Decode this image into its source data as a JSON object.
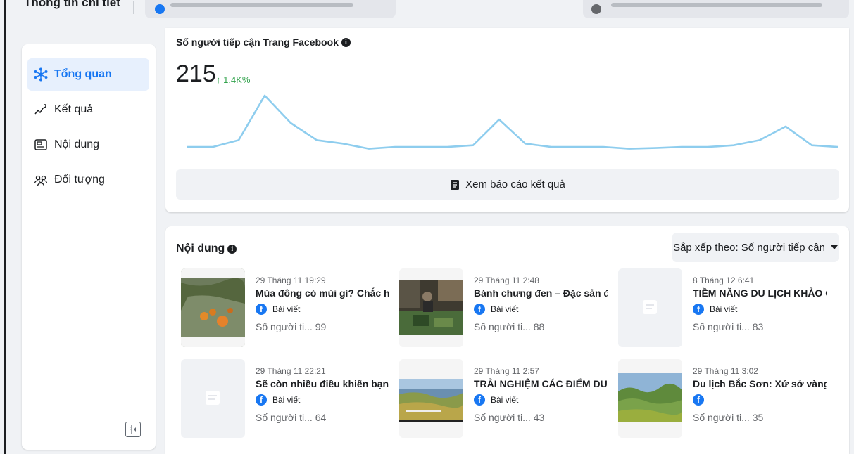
{
  "topbar": {
    "title": "Thông tin chi tiết"
  },
  "sidebar": {
    "items": [
      {
        "label": "Tổng quan",
        "icon": "overview-icon",
        "active": true
      },
      {
        "label": "Kết quả",
        "icon": "results-icon",
        "active": false
      },
      {
        "label": "Nội dung",
        "icon": "content-icon",
        "active": false
      },
      {
        "label": "Đối tượng",
        "icon": "audience-icon",
        "active": false
      }
    ]
  },
  "reach": {
    "title": "Số người tiếp cận Trang Facebook",
    "value": "215",
    "change": "↑ 1,4K%",
    "report_button": "Xem báo cáo kết quả",
    "chart_data": {
      "type": "line",
      "series": [
        {
          "values": [
            1,
            1,
            3,
            16,
            8,
            3,
            2,
            0.5,
            1,
            1,
            1,
            1.5,
            9,
            2,
            1,
            1,
            1,
            0.5,
            0.7,
            1,
            1,
            1.5,
            3,
            7,
            1.5,
            1
          ]
        }
      ],
      "grid": false,
      "color": "#8ecdee"
    }
  },
  "content": {
    "title": "Nội dung",
    "sort_label": "Sắp xếp theo: Số người tiếp cận",
    "posts": [
      {
        "date": "29 Tháng 11 19:29",
        "title": "Mùa đông có mùi gì? Chắc hẳ...",
        "type": "Bài viết",
        "reach": "Số người ti... 99",
        "thumb": "photo-oranges"
      },
      {
        "date": "29 Tháng 11 2:48",
        "title": "Bánh chưng đen – Đặc sản đ...",
        "type": "Bài viết",
        "reach": "Số người ti... 88",
        "thumb": "photo-market"
      },
      {
        "date": "8 Tháng 12 6:41",
        "title": "TIỀM NĂNG DU LỊCH KHẢO C...",
        "type": "Bài viết",
        "reach": "Số người ti... 83",
        "thumb": "placeholder"
      },
      {
        "date": "29 Tháng 11 22:21",
        "title": "Sẽ còn nhiều điều khiến bạn b...",
        "type": "Bài viết",
        "reach": "Số người ti... 64",
        "thumb": "placeholder"
      },
      {
        "date": "29 Tháng 11 2:57",
        "title": "TRẢI NGHIỆM CÁC ĐIỂM DU ...",
        "type": "Bài viết",
        "reach": "Số người ti... 43",
        "thumb": "photo-landscape"
      },
      {
        "date": "29 Tháng 11 3:02",
        "title": "Du lịch Bắc Sơn: Xứ sở vàng -...",
        "type": "",
        "reach": "Số người ti... 35",
        "thumb": "photo-valley"
      }
    ]
  },
  "colors": {
    "accent": "#1877f2",
    "positive": "#31a24c",
    "chart_line": "#8ecdee"
  }
}
